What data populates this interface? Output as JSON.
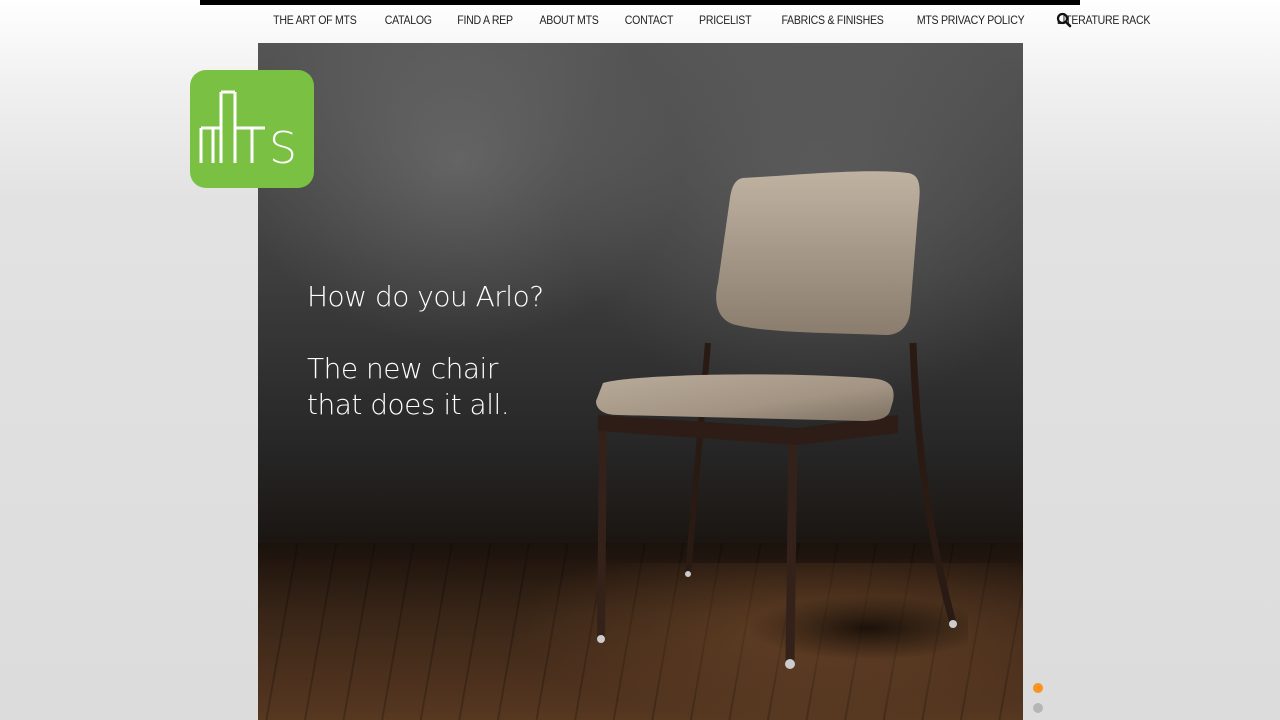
{
  "nav": {
    "items": [
      "THE ART OF MTS",
      "CATALOG",
      "FIND A REP",
      "ABOUT MTS",
      "CONTACT",
      "PRICELIST",
      "FABRICS & FINISHES",
      "MTS PRIVACY POLICY",
      "LITERATURE RACK"
    ],
    "search_icon": "search-icon"
  },
  "logo": {
    "text": "MTS",
    "color": "#7ac143"
  },
  "hero": {
    "headline": "How do you Arlo?",
    "subline_1": "The new chair",
    "subline_2": "that does it all."
  },
  "slider": {
    "slide_count": 2,
    "active_index": 0,
    "active_color": "#f7941d",
    "inactive_color": "#b5b5b5"
  }
}
